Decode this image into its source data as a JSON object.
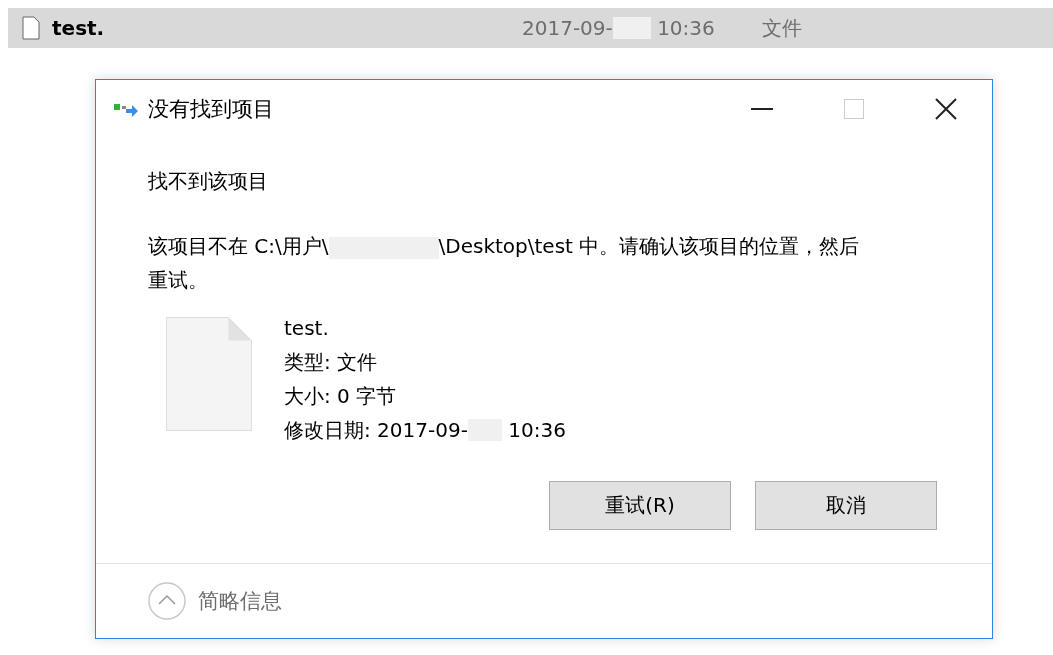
{
  "file_row": {
    "name": "test.",
    "date_before": "2017-09-",
    "time": "10:36",
    "type": "文件",
    "selected": true
  },
  "dialog": {
    "title": "没有找到项目",
    "heading": "找不到该项目",
    "message": {
      "before": "该项目不在 C:\\用户\\",
      "after": "\\Desktop\\test 中。请确认该项目的位置，然后重试。"
    },
    "details": {
      "name": "test.",
      "type": "类型: 文件",
      "size": "大小: 0 字节",
      "modified_before": "修改日期: 2017-09-",
      "modified_time": "10:36"
    },
    "buttons": [
      {
        "label": "重试(R)"
      },
      {
        "label": "取消"
      }
    ],
    "footer": {
      "label": "简略信息",
      "expanded": true
    }
  }
}
